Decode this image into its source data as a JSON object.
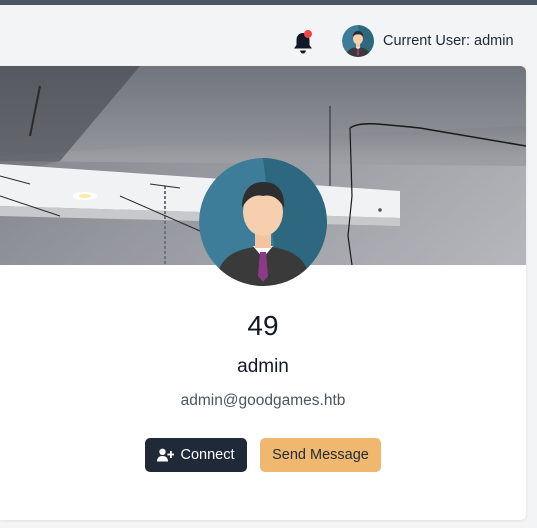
{
  "header": {
    "notification_icon": "bell-icon",
    "current_user_label": "Current User: admin"
  },
  "profile": {
    "id": "49",
    "name": "admin",
    "email": "admin@goodgames.htb",
    "avatar_icon": "user-avatar-icon"
  },
  "actions": {
    "connect_label": "Connect",
    "connect_icon": "user-plus-icon",
    "message_label": "Send Message"
  },
  "colors": {
    "connect_bg": "#1f2937",
    "message_bg": "#f0b86e",
    "notification_dot": "#ef4444"
  }
}
